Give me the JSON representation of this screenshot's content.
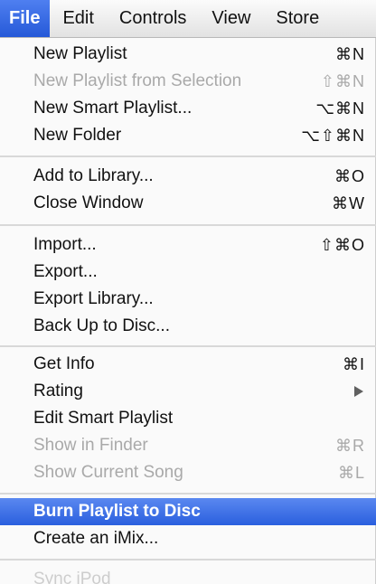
{
  "menubar": {
    "items": [
      "File",
      "Edit",
      "Controls",
      "View",
      "Store"
    ]
  },
  "menu": {
    "new_playlist": {
      "label": "New Playlist",
      "shortcut": "⌘N"
    },
    "new_playlist_from_selection": {
      "label": "New Playlist from Selection",
      "shortcut": "⇧⌘N"
    },
    "new_smart_playlist": {
      "label": "New Smart Playlist...",
      "shortcut": "⌥⌘N"
    },
    "new_folder": {
      "label": "New Folder",
      "shortcut": "⌥⇧⌘N"
    },
    "add_to_library": {
      "label": "Add to Library...",
      "shortcut": "⌘O"
    },
    "close_window": {
      "label": "Close Window",
      "shortcut": "⌘W"
    },
    "import": {
      "label": "Import...",
      "shortcut": "⇧⌘O"
    },
    "export": {
      "label": "Export..."
    },
    "export_library": {
      "label": "Export Library..."
    },
    "back_up_to_disc": {
      "label": "Back Up to Disc..."
    },
    "get_info": {
      "label": "Get Info",
      "shortcut": "⌘I"
    },
    "rating": {
      "label": "Rating"
    },
    "edit_smart_playlist": {
      "label": "Edit Smart Playlist"
    },
    "show_in_finder": {
      "label": "Show in Finder",
      "shortcut": "⌘R"
    },
    "show_current_song": {
      "label": "Show Current Song",
      "shortcut": "⌘L"
    },
    "burn_playlist_to_disc": {
      "label": "Burn Playlist to Disc"
    },
    "create_an_imix": {
      "label": "Create an iMix..."
    },
    "sync_ipod": {
      "label": "Sync iPod"
    }
  }
}
